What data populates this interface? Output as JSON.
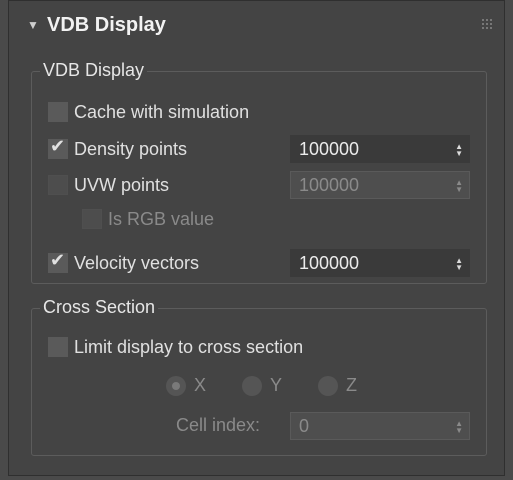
{
  "rollout": {
    "title": "VDB Display",
    "arrow": "▼"
  },
  "vdb_group": {
    "title": "VDB Display",
    "cache_with_simulation": {
      "label": "Cache with simulation",
      "checked": false
    },
    "density_points": {
      "label": "Density points",
      "checked": true,
      "value": "100000"
    },
    "uvw_points": {
      "label": "UVW points",
      "checked": false,
      "value": "100000"
    },
    "is_rgb_value": {
      "label": "Is RGB value",
      "checked": false
    },
    "velocity_vectors": {
      "label": "Velocity vectors",
      "checked": true,
      "value": "100000"
    }
  },
  "cross_section_group": {
    "title": "Cross Section",
    "limit_display": {
      "label": "Limit display to cross section",
      "checked": false
    },
    "axis_options": [
      "X",
      "Y",
      "Z"
    ],
    "selected_axis": "X",
    "cell_index": {
      "label": "Cell index:",
      "value": "0"
    }
  },
  "icons": {
    "checkmark": "✔",
    "spin_up": "▲",
    "spin_down": "▼"
  }
}
